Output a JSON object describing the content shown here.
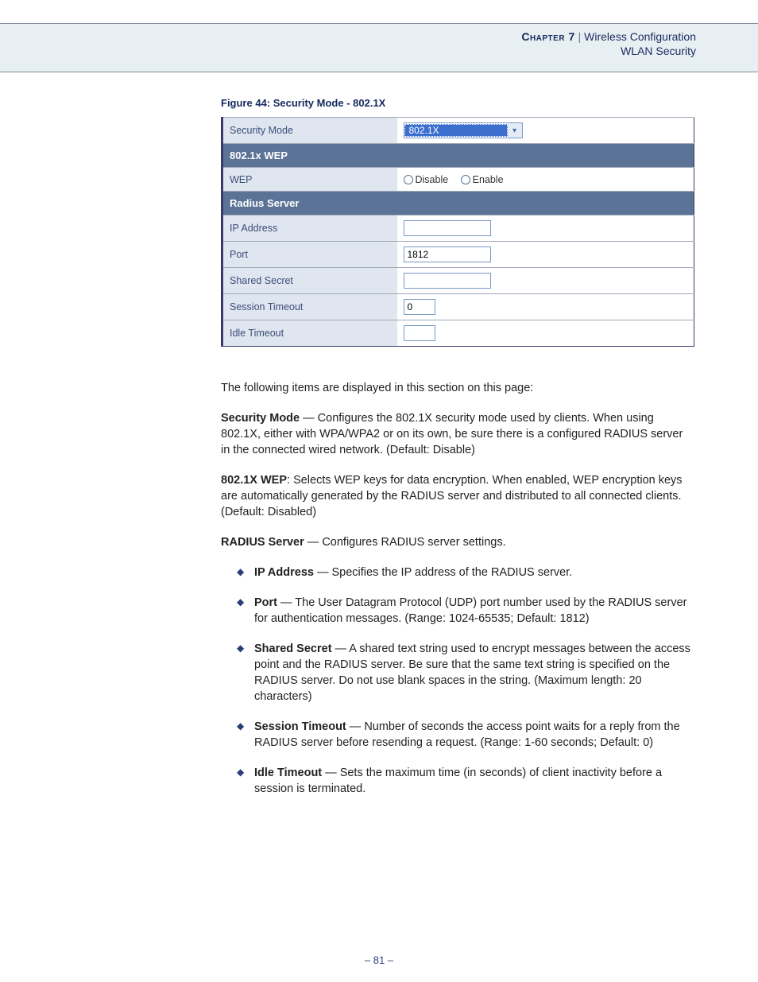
{
  "header": {
    "chapter": "Chapter 7",
    "sep": "|",
    "title": "Wireless Configuration",
    "subtitle": "WLAN Security"
  },
  "figure": {
    "caption": "Figure 44:  Security Mode - 802.1X"
  },
  "table": {
    "security_mode_label": "Security Mode",
    "security_mode_value": "802.1X",
    "section1": "802.1x WEP",
    "wep_label": "WEP",
    "wep_opt_disable": "Disable",
    "wep_opt_enable": "Enable",
    "section2": "Radius Server",
    "ip_label": "IP Address",
    "ip_value": "",
    "port_label": "Port",
    "port_value": "1812",
    "secret_label": "Shared Secret",
    "secret_value": "",
    "session_label": "Session Timeout",
    "session_value": "0",
    "idle_label": "Idle Timeout",
    "idle_value": ""
  },
  "body": {
    "intro": "The following items are displayed in this section on this page:",
    "p1_bold": "Security Mode",
    "p1_rest": " — Configures the 802.1X security mode used by clients. When using 802.1X, either with WPA/WPA2 or on its own, be sure there is a configured RADIUS server in the connected wired network. (Default: Disable)",
    "p2_bold": "802.1X WEP",
    "p2_rest": ": Selects WEP keys for data encryption. When enabled, WEP encryption keys are automatically generated by the RADIUS server and distributed to all connected clients. (Default: Disabled)",
    "p3_bold": "RADIUS Server",
    "p3_rest": " — Configures RADIUS server settings.",
    "bullets": {
      "b1_bold": "IP Address",
      "b1_rest": " — Specifies the IP address of the RADIUS server.",
      "b2_bold": "Port",
      "b2_rest": " — The User Datagram Protocol (UDP) port number used by the RADIUS server for authentication messages. (Range: 1024-65535; Default: 1812)",
      "b3_bold": "Shared Secret",
      "b3_rest": " — A shared text string used to encrypt messages between the access point and the RADIUS server. Be sure that the same text string is specified on the RADIUS server. Do not use blank spaces in the string. (Maximum length: 20 characters)",
      "b4_bold": "Session Timeout",
      "b4_rest": " — Number of seconds the access point waits for a reply from the RADIUS server before resending a request. (Range: 1-60 seconds; Default: 0)",
      "b5_bold": "Idle Timeout",
      "b5_rest": " — Sets the maximum time (in seconds) of client inactivity before a session is terminated."
    }
  },
  "page_number": "–  81  –"
}
